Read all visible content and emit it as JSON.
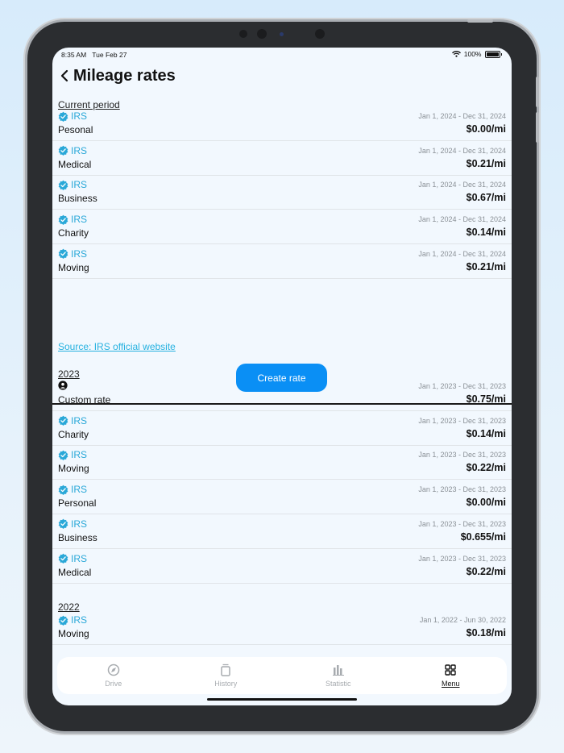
{
  "status_bar": {
    "time": "8:35 AM",
    "date": "Tue Feb 27",
    "battery": "100%"
  },
  "header": {
    "title": "Mileage rates"
  },
  "sections": [
    {
      "title": "Current period",
      "rows": [
        {
          "source": "IRS",
          "name": "Pesonal",
          "dates": "Jan 1, 2024 - Dec 31, 2024",
          "price": "$0.00/mi"
        },
        {
          "source": "IRS",
          "name": "Medical",
          "dates": "Jan 1, 2024 - Dec 31, 2024",
          "price": "$0.21/mi"
        },
        {
          "source": "IRS",
          "name": "Business",
          "dates": "Jan 1, 2024 - Dec 31, 2024",
          "price": "$0.67/mi"
        },
        {
          "source": "IRS",
          "name": "Charity",
          "dates": "Jan 1, 2024 - Dec 31, 2024",
          "price": "$0.14/mi"
        },
        {
          "source": "IRS",
          "name": "Moving",
          "dates": "Jan 1, 2024 - Dec 31, 2024",
          "price": "$0.21/mi"
        }
      ],
      "source_link": "Source: IRS official website",
      "create_button": "Create rate"
    },
    {
      "title": "2023",
      "rows": [
        {
          "source": "",
          "name": "Custom rate",
          "dates": "Jan 1, 2023 - Dec 31, 2023",
          "price": "$0.75/mi"
        },
        {
          "source": "IRS",
          "name": "Charity",
          "dates": "Jan 1, 2023 - Dec 31, 2023",
          "price": "$0.14/mi"
        },
        {
          "source": "IRS",
          "name": "Moving",
          "dates": "Jan 1, 2023 - Dec 31, 2023",
          "price": "$0.22/mi"
        },
        {
          "source": "IRS",
          "name": "Personal",
          "dates": "Jan 1, 2023 - Dec 31, 2023",
          "price": "$0.00/mi"
        },
        {
          "source": "IRS",
          "name": "Business",
          "dates": "Jan 1, 2023 - Dec 31, 2023",
          "price": "$0.655/mi"
        },
        {
          "source": "IRS",
          "name": "Medical",
          "dates": "Jan 1, 2023 - Dec 31, 2023",
          "price": "$0.22/mi"
        }
      ]
    },
    {
      "title": "2022",
      "rows": [
        {
          "source": "IRS",
          "name": "Moving",
          "dates": "Jan 1, 2022 - Jun 30, 2022",
          "price": "$0.18/mi"
        }
      ]
    }
  ],
  "tabs": [
    {
      "label": "Drive",
      "icon": "compass-icon",
      "active": false
    },
    {
      "label": "History",
      "icon": "history-icon",
      "active": false
    },
    {
      "label": "Statistic",
      "icon": "bar-chart-icon",
      "active": false
    },
    {
      "label": "Menu",
      "icon": "grid-icon",
      "active": true
    }
  ],
  "colors": {
    "accent": "#0a8ff5",
    "irs": "#2aa8d8",
    "background": "#f2f8fe"
  }
}
